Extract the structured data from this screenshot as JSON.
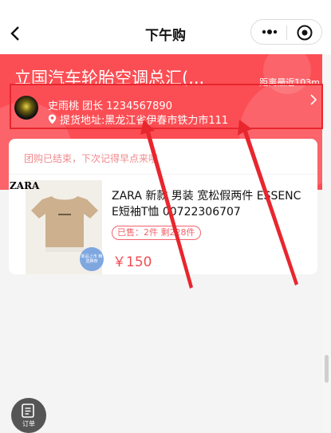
{
  "nav": {
    "title": "下午购",
    "back_icon": "chevron-left-icon",
    "more_icon": "more-dots-icon",
    "close_icon": "target-close-icon"
  },
  "store": {
    "name": "立国汽车轮胎空调总汇(...",
    "distance": "距离最近103m",
    "leader_line": "史雨桃 团长 1234567890",
    "pickup_address": "提货地址:黑龙江省伊春市铁力市111"
  },
  "notice": {
    "text": "团购已结束，下次记得早点来哦"
  },
  "product": {
    "brand_logo": "ZARA",
    "title": "ZARA 新款 男装 宽松假两件 ESSENCE短袖T恤 00722306707",
    "sold_text": "已售：2件  剩228件",
    "price": "￥150",
    "badge_text": "新品上市 精选推荐"
  },
  "order_button": {
    "label": "订单"
  },
  "colors": {
    "header_red": "#fb4e54",
    "price_red": "#f14d55",
    "annotation_red": "#e8262e"
  }
}
